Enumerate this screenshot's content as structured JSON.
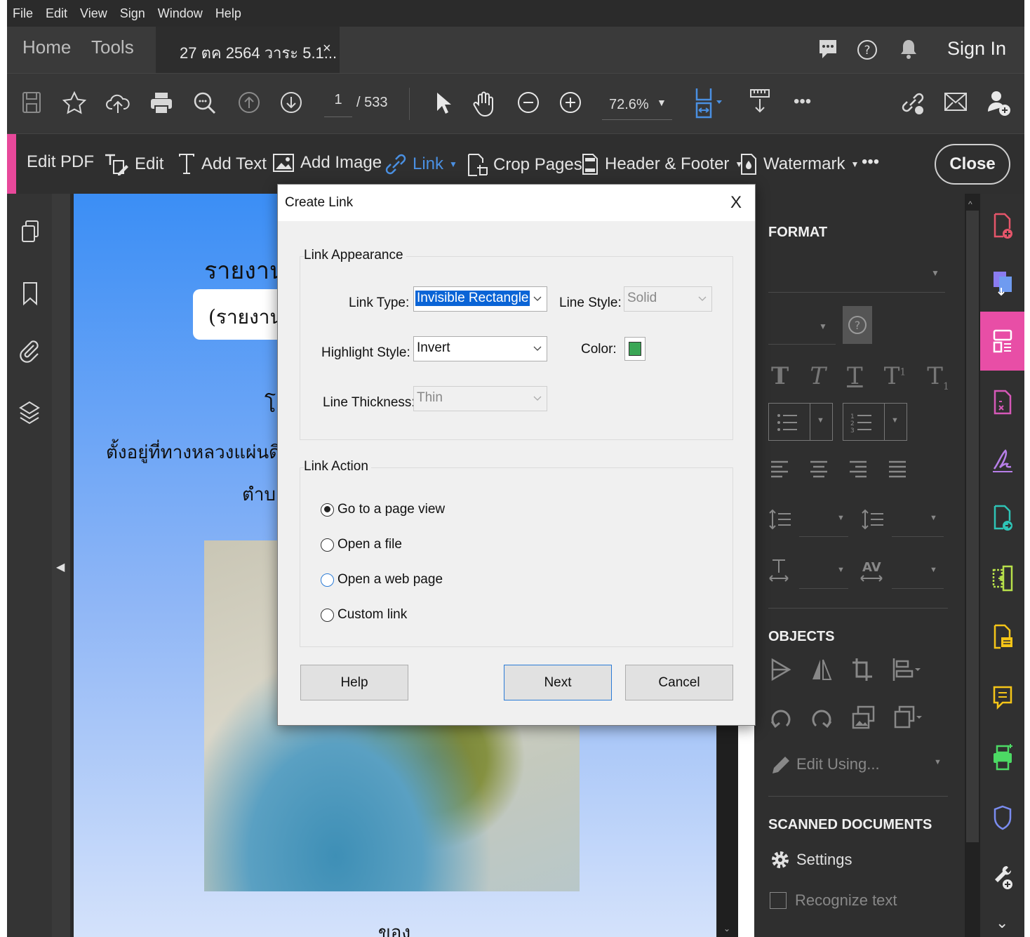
{
  "menu": [
    "File",
    "Edit",
    "View",
    "Sign",
    "Window",
    "Help"
  ],
  "tabs": {
    "home": "Home",
    "tools": "Tools",
    "document": "27 ตค 2564 วาระ 5.1...",
    "close_tab": "×"
  },
  "header": {
    "sign_in": "Sign In"
  },
  "toolbar": {
    "page_current": "1",
    "page_total": "/ 533",
    "zoom": "72.6%"
  },
  "edit_pdf": {
    "title": "Edit PDF",
    "edit": "Edit",
    "add_text": "Add Text",
    "add_image": "Add Image",
    "link": "Link",
    "crop_pages": "Crop Pages",
    "header_footer": "Header & Footer",
    "watermark": "Watermark",
    "more": "•••",
    "close": "Close"
  },
  "document": {
    "line1": "รายงาน",
    "line2": "(รายงาน",
    "line3": "โ",
    "line4": "ตั้งอยู่ที่ทางหลวงแผ่นดินห",
    "line5": "ตำบล",
    "line6": "ของ"
  },
  "dialog": {
    "title": "Create Link",
    "close": "X",
    "appearance_legend": "Link Appearance",
    "link_type_label": "Link Type:",
    "link_type_value": "Invisible Rectangle",
    "line_style_label": "Line Style:",
    "line_style_value": "Solid",
    "highlight_label": "Highlight Style:",
    "highlight_value": "Invert",
    "color_label": "Color:",
    "color_value": "#3aa655",
    "thickness_label": "Line Thickness:",
    "thickness_value": "Thin",
    "action_legend": "Link Action",
    "actions": [
      "Go to a page view",
      "Open a file",
      "Open a web page",
      "Custom link"
    ],
    "selected_action": "Go to a page view",
    "help": "Help",
    "next": "Next",
    "cancel": "Cancel"
  },
  "right_panel": {
    "format": "FORMAT",
    "objects": "OBJECTS",
    "edit_using": "Edit Using...",
    "scanned": "SCANNED DOCUMENTS",
    "settings": "Settings",
    "recognize": "Recognize text"
  },
  "colors": {
    "accent_pink": "#e8489a",
    "focus_blue": "#2a7bd6",
    "link_blue": "#4a90e2"
  }
}
